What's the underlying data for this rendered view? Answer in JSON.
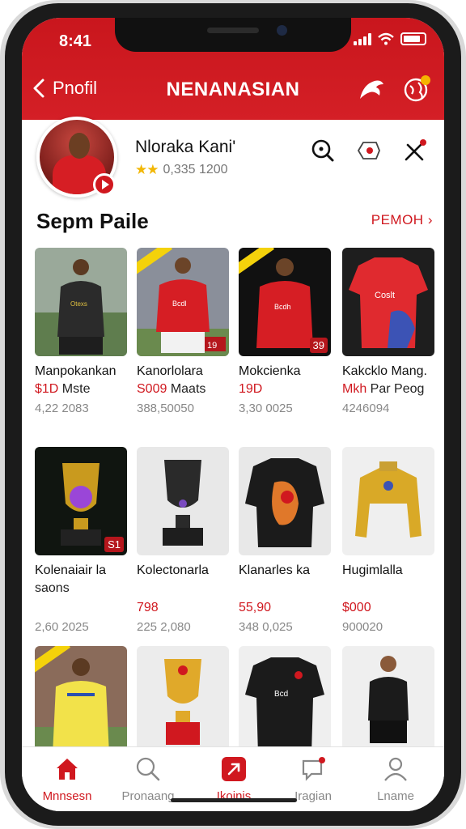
{
  "status": {
    "time": "8:41"
  },
  "header": {
    "back_label": "Pnofil",
    "title": "NENANASIAN"
  },
  "profile": {
    "name": "Nloraka Kani'",
    "rating_text": "0,335 1200",
    "stars": 2
  },
  "section": {
    "title": "Sepm Paile",
    "more_label": "PEMOH"
  },
  "items": [
    {
      "title": "Manpokankan",
      "price": "$1D",
      "price_rest": " Mste",
      "meta": "4,22 2083",
      "thumb": "jersey-player-dark",
      "badge": "",
      "ribbon": false
    },
    {
      "title": "Kanorlolara",
      "price": "S009",
      "price_rest": " Maats",
      "meta": "388,50050",
      "thumb": "jersey-player-red",
      "badge": "",
      "ribbon": true
    },
    {
      "title": "Mokcienka",
      "price": "19D",
      "price_rest": "",
      "meta": "3,30 0025",
      "thumb": "jersey-player-red-dark",
      "badge": "39",
      "ribbon": true
    },
    {
      "title": "Kakcklo Mang.",
      "price": "Mkh",
      "price_rest": " Par Peog",
      "meta": "4246094",
      "thumb": "jersey-red-shirt",
      "badge": "",
      "ribbon": false
    },
    {
      "title": "Kolenaiair la",
      "sub": "saons",
      "price": "",
      "meta": "2,60 2025",
      "thumb": "trophy-gold-purple",
      "badge": "S1",
      "ribbon": false
    },
    {
      "title": "Kolectonarla",
      "sub": "",
      "price": "798",
      "meta": "225 2,080",
      "thumb": "trophy-black",
      "badge": "",
      "ribbon": false
    },
    {
      "title": "Klanarles ka",
      "sub": "",
      "price": "55,90",
      "meta": "348 0,025",
      "thumb": "jersey-black-dragon",
      "badge": "",
      "ribbon": false
    },
    {
      "title": "Hugimlalla",
      "sub": "",
      "price": "$000",
      "meta": "900020",
      "thumb": "jersey-gold",
      "badge": "",
      "ribbon": false
    },
    {
      "title": "",
      "price": "",
      "meta": "",
      "thumb": "jersey-player-yellow",
      "badge": "",
      "ribbon": true
    },
    {
      "title": "",
      "price": "",
      "meta": "",
      "thumb": "trophy-gold-red",
      "badge": "",
      "ribbon": false
    },
    {
      "title": "",
      "price": "",
      "meta": "",
      "thumb": "jersey-black-shirt",
      "badge": "",
      "ribbon": false
    },
    {
      "title": "",
      "price": "",
      "meta": "",
      "thumb": "jersey-player-black",
      "badge": "",
      "ribbon": false
    }
  ],
  "bottom_nav": [
    {
      "label": "Mnnsesn",
      "icon": "home-icon",
      "active": true
    },
    {
      "label": "Pronaang",
      "icon": "search-icon",
      "active": false
    },
    {
      "label": "Ikoinis",
      "icon": "collection-icon",
      "active": true
    },
    {
      "label": "Iragian",
      "icon": "chat-icon",
      "active": false
    },
    {
      "label": "Lname",
      "icon": "user-icon",
      "active": false
    }
  ],
  "colors": {
    "brand_red": "#d0181f",
    "star": "#f2b705"
  }
}
